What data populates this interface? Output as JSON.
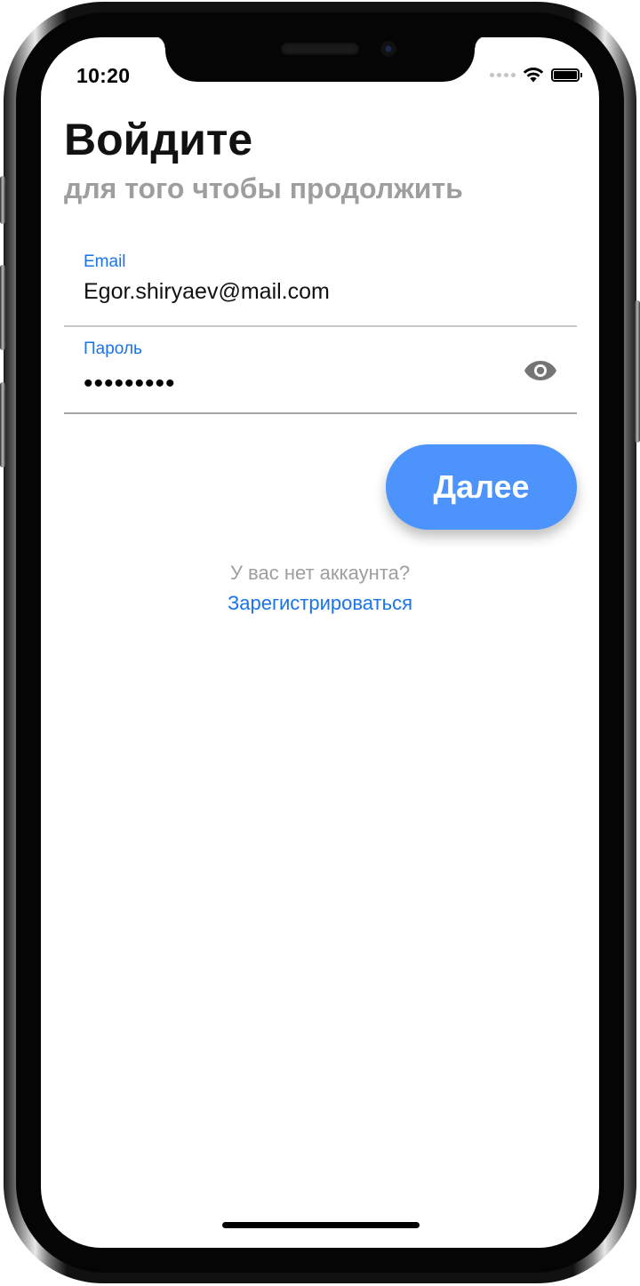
{
  "status_bar": {
    "time": "10:20",
    "icons": [
      "cellular-dots-icon",
      "wifi-icon",
      "battery-icon"
    ]
  },
  "header": {
    "title": "Войдите",
    "subtitle": "для того чтобы продолжить"
  },
  "form": {
    "email": {
      "label": "Email",
      "value": "Egor.shiryaev@mail.com"
    },
    "password": {
      "label": "Пароль",
      "masked_value": "•••••••••",
      "toggle_icon": "eye-icon"
    },
    "next_label": "Далее"
  },
  "footer": {
    "no_account_text": "У вас нет аккаунта?",
    "register_label": "Зарегистрироваться"
  },
  "colors": {
    "accent": "#1a73e8",
    "button": "#4c94fb",
    "muted_text": "#9e9e9e"
  }
}
